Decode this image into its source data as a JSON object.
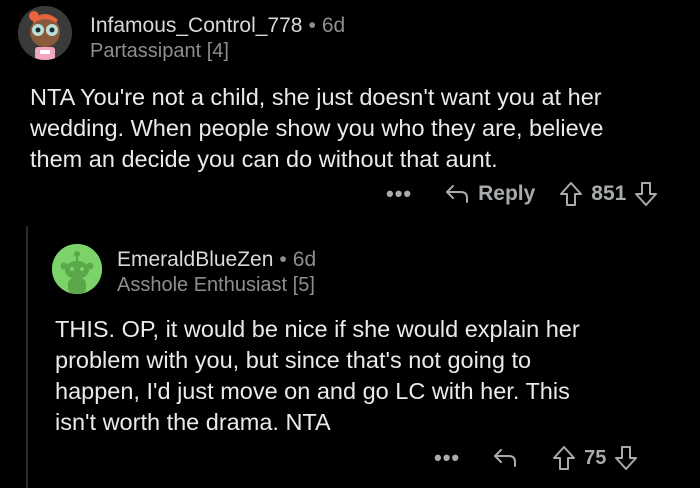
{
  "comments": [
    {
      "username": "Infamous_Control_778",
      "age": "6d",
      "flair": "Partassipant [4]",
      "body_lines": [
        "NTA You're not a child, she just doesn't want you at her",
        "wedding. When people show you who they are, believe",
        "them an decide you can do without that aunt."
      ],
      "more": "•••",
      "reply_label": "Reply",
      "score": "851"
    },
    {
      "username": "EmeraldBlueZen",
      "age": "6d",
      "flair": "Asshole Enthusiast [5]",
      "body_lines": [
        "THIS. OP,  it would be nice if she would explain her",
        "problem with you, but since that's not going to",
        "happen, I'd just move on and go LC with her. This",
        "isn't worth the drama.  NTA"
      ],
      "more": "•••",
      "score": "75"
    }
  ],
  "dot_separator": "•",
  "colors": {
    "background": "#000000",
    "text": "#e8eaeb",
    "muted": "#8b8f91",
    "avatar2_bg": "#7cd36a"
  }
}
